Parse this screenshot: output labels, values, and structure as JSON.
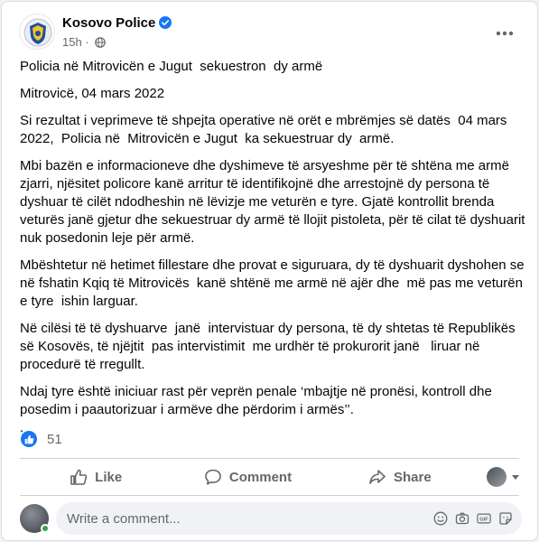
{
  "post": {
    "page_name": "Kosovo Police",
    "time_ago": "15h",
    "paragraphs": [
      "Policia në Mitrovicën e Jugut  sekuestron  dy armë",
      "Mitrovicë, 04 mars 2022",
      "Si rezultat i veprimeve të shpejta operative në orët e mbrëmjes së datës  04 mars 2022,  Policia në  Mitrovicën e Jugut  ka sekuestruar dy  armë.",
      "Mbi bazën e informacioneve dhe dyshimeve të arsyeshme për të shtëna me armë zjarri, njësitet policore kanë arritur të identifikojnë dhe arrestojnë dy persona të dyshuar të cilët ndodheshin në lëvizje me veturën e tyre. Gjatë kontrollit brenda veturës janë gjetur dhe sekuestruar dy armë të llojit pistoleta, për të cilat të dyshuarit nuk posedonin leje për armë.",
      "Mbështetur në hetimet fillestare dhe provat e siguruara, dy të dyshuarit dyshohen se në fshatin Kqiq të Mitrovicës  kanë shtënë me armë në ajër dhe  më pas me veturën e tyre  ishin larguar.",
      "Në cilësi të të dyshuarve  janë  intervistuar dy persona, të dy shtetas të Republikës së Kosovës, të njëjtit  pas intervistimit  me urdhër të prokurorit janë   liruar në procedurë të rregullt.",
      "Ndaj tyre është iniciuar rast për veprën penale ‘mbajtje në pronësi, kontroll dhe posedim i paautorizuar i armëve dhe përdorim i armës’’."
    ],
    "trailing": "."
  },
  "reactions": {
    "count": "51"
  },
  "actions": {
    "like": "Like",
    "comment": "Comment",
    "share": "Share"
  },
  "composer": {
    "placeholder": "Write a comment..."
  },
  "colors": {
    "brand_blue": "#1877f2",
    "secondary_text": "#65676b"
  }
}
